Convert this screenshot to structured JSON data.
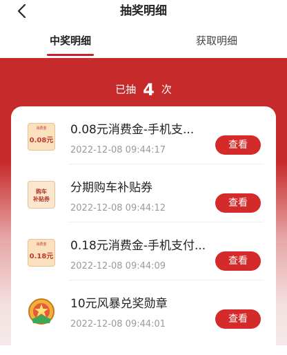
{
  "header": {
    "title": "抽奖明细"
  },
  "tabs": [
    {
      "label": "中奖明细",
      "active": true
    },
    {
      "label": "获取明细",
      "active": false
    }
  ],
  "summary": {
    "prefix": "已抽",
    "count": "4",
    "suffix": "次"
  },
  "records": [
    {
      "title": "0.08元消费金-手机支...",
      "time": "2022-12-08 09:44:17",
      "button": "查看",
      "thumb": {
        "type": "coupon",
        "small": "消费金",
        "value": "0.08元"
      }
    },
    {
      "title": "分期购车补贴券",
      "time": "2022-12-08 09:44:12",
      "button": "查看",
      "thumb": {
        "type": "car",
        "line1": "购车",
        "line2": "补贴券"
      }
    },
    {
      "title": "0.18元消费金-手机支付...",
      "time": "2022-12-08 09:44:09",
      "button": "查看",
      "thumb": {
        "type": "coupon",
        "small": "消费金",
        "value": "0.18元"
      }
    },
    {
      "title": "10元风暴兑奖勋章",
      "time": "2022-12-08 09:44:01",
      "button": "查看",
      "thumb": {
        "type": "medal"
      }
    }
  ],
  "colors": {
    "accent": "#c8202a",
    "button": "#d42a2a",
    "panel": "#c62a2a"
  }
}
